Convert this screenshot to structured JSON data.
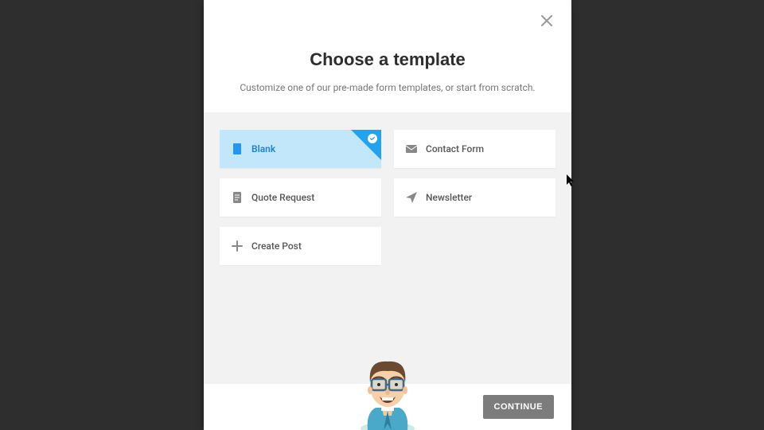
{
  "modal": {
    "title": "Choose a template",
    "subtitle": "Customize one of our pre-made form templates, or start from scratch."
  },
  "templates": [
    {
      "label": "Blank",
      "icon": "file-icon",
      "selected": true
    },
    {
      "label": "Contact Form",
      "icon": "envelope-icon",
      "selected": false
    },
    {
      "label": "Quote Request",
      "icon": "document-icon",
      "selected": false
    },
    {
      "label": "Newsletter",
      "icon": "paperplane-icon",
      "selected": false
    },
    {
      "label": "Create Post",
      "icon": "plus-icon",
      "selected": false
    }
  ],
  "footer": {
    "continue_label": "CONTINUE"
  },
  "colors": {
    "accent": "#23a3ef",
    "selected_bg": "#c2e7fb",
    "modal_bg": "#ffffff",
    "body_bg": "#2e2e2e",
    "templates_bg": "#f2f2f2",
    "button_bg": "#7c7c7c"
  }
}
